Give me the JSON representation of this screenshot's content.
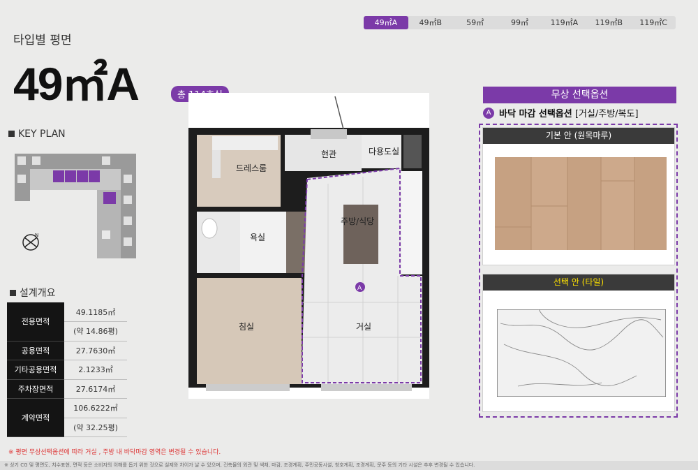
{
  "tabs": [
    {
      "label": "49㎡A",
      "active": true
    },
    {
      "label": "49㎡B"
    },
    {
      "label": "59㎡"
    },
    {
      "label": "99㎡"
    },
    {
      "label": "119㎡A"
    },
    {
      "label": "119㎡B"
    },
    {
      "label": "119㎡C"
    }
  ],
  "header": {
    "section_title": "타입별 평면",
    "type_title": "49㎡A",
    "units_badge": "총 114호실"
  },
  "keyplan": {
    "label": "KEY PLAN",
    "compass_label": "N"
  },
  "specs": {
    "label": "설계개요",
    "rows": {
      "exclusive_label": "전용면적",
      "exclusive_value": "49.1185㎡",
      "exclusive_pyeong": "(약 14.86평)",
      "common_label": "공용면적",
      "common_value": "27.7630㎡",
      "other_label": "기타공용면적",
      "other_value": "2.1233㎡",
      "parking_label": "주차장면적",
      "parking_value": "27.6174㎡",
      "contract_label": "계약면적",
      "contract_value": "106.6222㎡",
      "contract_pyeong": "(약 32.25평)"
    }
  },
  "plan": {
    "rooms": {
      "dressroom": "드레스룸",
      "entrance": "현관",
      "utility": "다용도실",
      "kitchen": "주방/식당",
      "bath": "욕실",
      "bedroom": "침실",
      "living": "거실"
    },
    "marker": "A"
  },
  "options": {
    "header": "무상 선택옵션",
    "marker": "A",
    "subtitle": "바닥 마감 선택옵션",
    "subtitle_extra": "[거실/주방/복도]",
    "basic_title": "기본 안 (원목마루)",
    "select_title": "선택 안  (타일)"
  },
  "notes": {
    "note": "※ 평면 무상선택옵션에 따라 거실 , 주방 내  바닥마감 영역은 변경될 수 있습니다.",
    "footer": "※ 상기 CG 및 평면도, 치수표현, 면적 등은 소비자의 이해를 돕기 위한 것으로 실제와 차이가 날 수 있으며, 건축물의 외관 및 색채, 마감, 조경계획, 주민공동시설, 창호계획, 조경계획, 문주 등의 기타 시설은 추후 변경될 수 있습니다."
  },
  "colors": {
    "accent": "#7b3aa8",
    "dark": "#141414",
    "highlight": "#ffe300"
  }
}
